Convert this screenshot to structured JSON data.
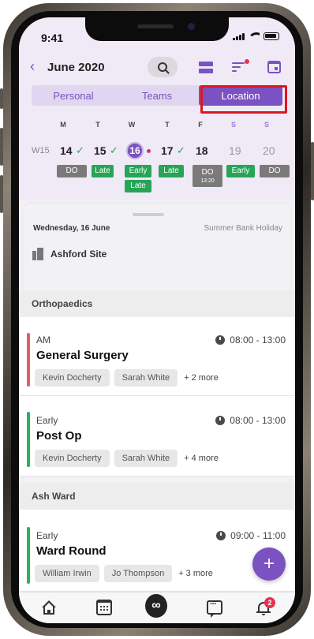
{
  "status_bar": {
    "time": "9:41"
  },
  "header": {
    "back_icon": "chevron-left-icon",
    "month": "June 2020"
  },
  "tabs": [
    {
      "label": "Personal",
      "active": false
    },
    {
      "label": "Teams",
      "active": false
    },
    {
      "label": "Location",
      "active": true
    }
  ],
  "week": {
    "label": "W15",
    "days": [
      {
        "dow": "M",
        "num": "14",
        "checked": true,
        "weekend": false,
        "today": false
      },
      {
        "dow": "T",
        "num": "15",
        "checked": true,
        "weekend": false,
        "today": false
      },
      {
        "dow": "W",
        "num": "16",
        "checked": false,
        "weekend": false,
        "today": true
      },
      {
        "dow": "T",
        "num": "17",
        "checked": true,
        "weekend": false,
        "today": false
      },
      {
        "dow": "F",
        "num": "18",
        "checked": false,
        "weekend": false,
        "today": false
      },
      {
        "dow": "S",
        "num": "19",
        "checked": false,
        "weekend": true,
        "today": false
      },
      {
        "dow": "S",
        "num": "20",
        "checked": false,
        "weekend": true,
        "today": false
      }
    ],
    "chips": {
      "mon": "DO",
      "tue": "Late",
      "wed_1": "Early",
      "wed_2": "Late",
      "thu": "Late",
      "fri": "DO",
      "fri_sub": "13:20",
      "sat": "Early",
      "sun": "DO"
    }
  },
  "day_view": {
    "date": "Wednesday, 16 June",
    "holiday": "Summer Bank Holiday",
    "site": "Ashford Site",
    "sections": [
      {
        "name": "Orthopaedics",
        "shifts": [
          {
            "type": "AM",
            "title": "General Surgery",
            "time": "08:00 - 13:00",
            "people": [
              "Kevin Docherty",
              "Sarah White"
            ],
            "more": "+ 2 more",
            "color": "#e0606a"
          },
          {
            "type": "Early",
            "title": "Post Op",
            "time": "08:00 - 13:00",
            "people": [
              "Kevin Docherty",
              "Sarah White"
            ],
            "more": "+ 4 more",
            "color": "#2bb062"
          }
        ]
      },
      {
        "name": "Ash Ward",
        "shifts": [
          {
            "type": "Early",
            "title": "Ward Round",
            "time": "09:00 - 11:00",
            "people": [
              "William Irwin",
              "Jo Thompson"
            ],
            "more": "+ 3 more",
            "color": "#2bb062"
          }
        ]
      }
    ]
  },
  "fab": {
    "label": "+"
  },
  "tabbar": {
    "items": [
      "home-icon",
      "calendar-icon",
      "infinity-icon",
      "chat-icon",
      "bell-icon"
    ],
    "center_label": "∞",
    "notification_count": "2"
  },
  "colors": {
    "accent": "#7b52c1",
    "green": "#27a557",
    "grey_chip": "#7a7a7a",
    "highlight": "#e0151f",
    "notification": "#e6334b"
  }
}
